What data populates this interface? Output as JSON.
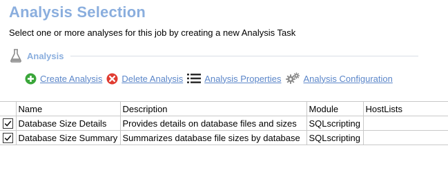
{
  "header": {
    "title": "Analysis Selection",
    "subtitle": "Select one or more analyses for this job by creating a new Analysis Task"
  },
  "section": {
    "label": "Analysis",
    "icon": "flask-icon"
  },
  "toolbar": {
    "create_label": "Create Analysis",
    "delete_label": "Delete Analysis",
    "properties_label": "Analysis Properties",
    "configuration_label": "Analysis Configuration"
  },
  "colors": {
    "title": "#8aaede",
    "link": "#5b86c9",
    "create_icon": "#3aa63a",
    "delete_icon": "#e03c31"
  },
  "table": {
    "columns": [
      "Name",
      "Description",
      "Module",
      "HostLists"
    ],
    "rows": [
      {
        "checked": true,
        "name": "Database Size Details",
        "description": "Provides details on database files and sizes",
        "module": "SQLscripting",
        "hostlists": ""
      },
      {
        "checked": true,
        "name": "Database Size Summary",
        "description": "Summarizes database file sizes by database",
        "module": "SQLscripting",
        "hostlists": ""
      }
    ]
  }
}
